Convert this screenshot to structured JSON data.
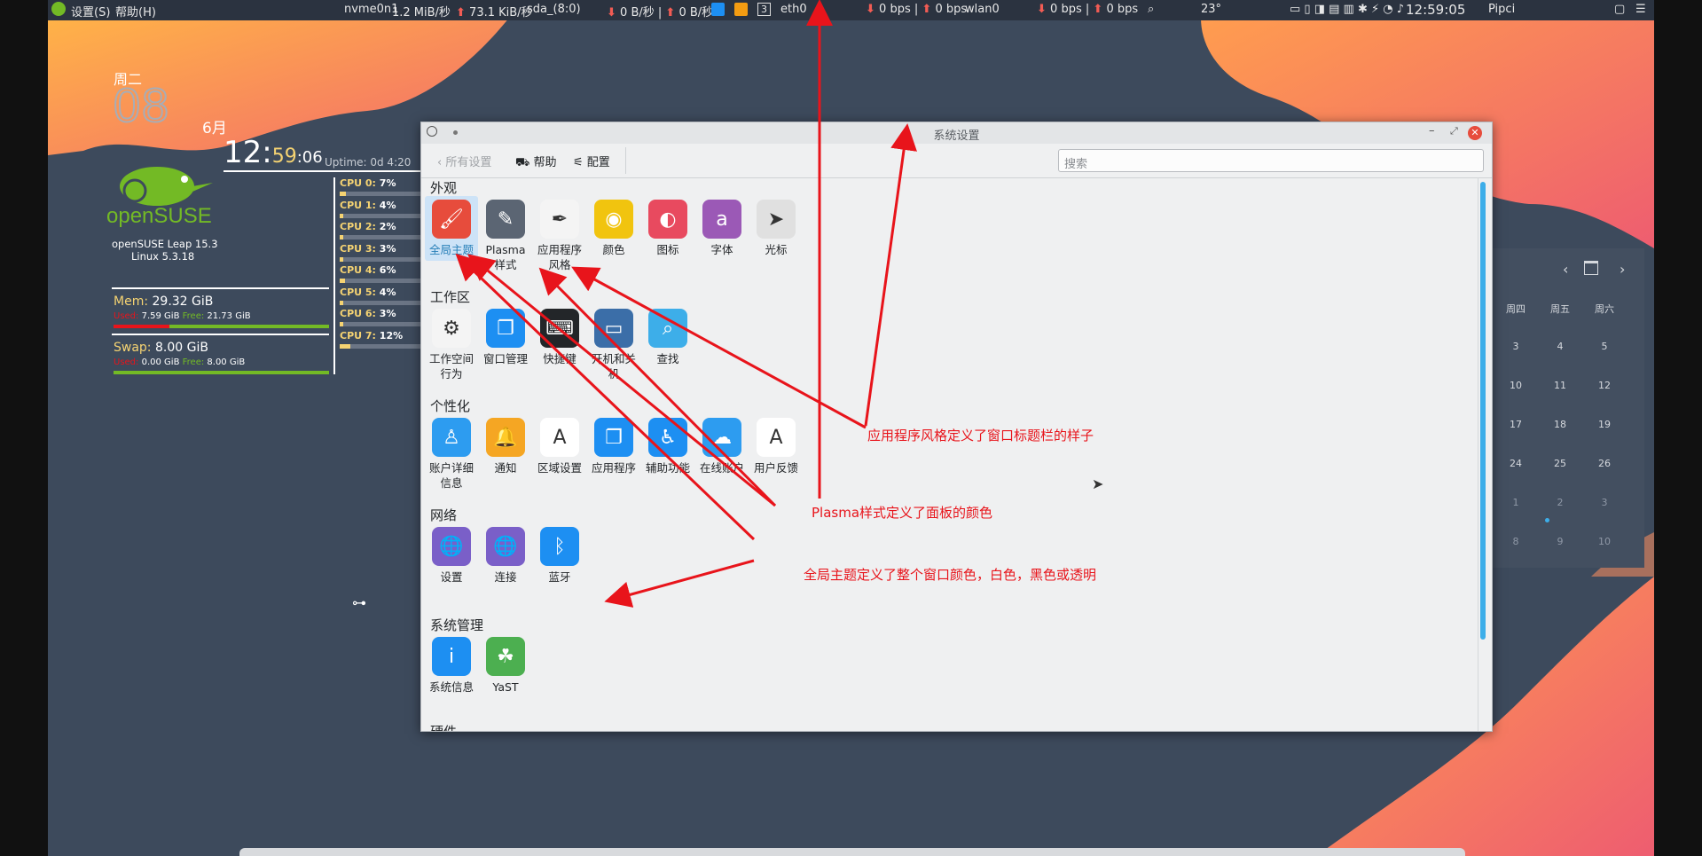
{
  "top_panel": {
    "menu_settings": "设置(S)",
    "menu_help": "帮助(H)",
    "disk_nvme": "nvme0n1",
    "disk_rate": "1.2 MiB/秒",
    "disk_up": "73.1 KiB/秒",
    "disk_sda": "sda_(8:0)",
    "sda_down": "0 B/秒",
    "sda_up": "0 B/秒",
    "workspace": "3",
    "eth": "eth0",
    "eth_down": "0 bps",
    "eth_up": "0 bps",
    "wlan": "wlan0",
    "wlan_down": "0 bps",
    "wlan_up": "0 bps",
    "weather": "23°",
    "battery": "100%",
    "clock": "12:59:05",
    "user": "Pipci"
  },
  "conky": {
    "weekday": "周二",
    "day": "08",
    "month": "6月",
    "time_hm": "12:",
    "time_m": "59",
    "time_s": ":06",
    "uptime": "Uptime: 0d 4:20",
    "os_logo": "openSUSE",
    "os_name": "openSUSE Leap 15.3",
    "kernel": "Linux 5.3.18",
    "mem_label": "Mem:",
    "mem_total": "29.32 GiB",
    "mem_used_label": "Used:",
    "mem_used": "7.59 GiB",
    "mem_free_label": "Free:",
    "mem_free": "21.73 GiB",
    "mem_used_frac": 0.26,
    "swap_label": "Swap:",
    "swap_total": "8.00 GiB",
    "swap_used_label": "Used:",
    "swap_used": "0.00 GiB",
    "swap_free_label": "Free:",
    "swap_free": "8.00 GiB",
    "swap_used_frac": 0.0,
    "cpus": [
      {
        "label": "CPU 0:",
        "value": "7%",
        "frac": 0.07
      },
      {
        "label": "CPU 1:",
        "value": "4%",
        "frac": 0.04
      },
      {
        "label": "CPU 2:",
        "value": "2%",
        "frac": 0.02
      },
      {
        "label": "CPU 3:",
        "value": "3%",
        "frac": 0.03
      },
      {
        "label": "CPU 4:",
        "value": "6%",
        "frac": 0.06
      },
      {
        "label": "CPU 5:",
        "value": "4%",
        "frac": 0.04
      },
      {
        "label": "CPU 6:",
        "value": "3%",
        "frac": 0.03
      },
      {
        "label": "CPU 7:",
        "value": "12%",
        "frac": 0.12
      }
    ]
  },
  "window": {
    "title": "系统设置",
    "back_label": "所有设置",
    "help_label": "帮助",
    "config_label": "配置",
    "search_placeholder": "搜索",
    "sections": [
      {
        "title": "外观",
        "items": [
          {
            "label": "全局主题",
            "icon": "global-theme-icon",
            "color": "#e74c3c",
            "selected": true
          },
          {
            "label": "Plasma\n样式",
            "icon": "plasma-style-icon",
            "color": "#5b6573"
          },
          {
            "label": "应用程序\n风格",
            "icon": "app-style-icon",
            "color": "#f4f4f4"
          },
          {
            "label": "颜色",
            "icon": "colors-icon",
            "color": "#f1c40f"
          },
          {
            "label": "图标",
            "icon": "icons-icon",
            "color": "#e84a5f"
          },
          {
            "label": "字体",
            "icon": "fonts-icon",
            "color": "#9b59b6"
          },
          {
            "label": "光标",
            "icon": "cursor-icon",
            "color": "#e0e0e0"
          }
        ]
      },
      {
        "title": "工作区",
        "items": [
          {
            "label": "工作空间\n行为",
            "icon": "workspace-behavior-icon",
            "color": "#f4f4f4"
          },
          {
            "label": "窗口管理",
            "icon": "window-management-icon",
            "color": "#1d8ff2"
          },
          {
            "label": "快捷键",
            "icon": "shortcuts-icon",
            "color": "#232629"
          },
          {
            "label": "开机和关\n机",
            "icon": "startup-shutdown-icon",
            "color": "#3b6ea8"
          },
          {
            "label": "查找",
            "icon": "search-icon",
            "color": "#3daee9"
          }
        ]
      },
      {
        "title": "个性化",
        "items": [
          {
            "label": "账户详细\n信息",
            "icon": "user-account-icon",
            "color": "#2d9cf0"
          },
          {
            "label": "通知",
            "icon": "notification-bell-icon",
            "color": "#f5a623"
          },
          {
            "label": "区域设置",
            "icon": "regional-settings-icon",
            "color": "#ffffff"
          },
          {
            "label": "应用程序",
            "icon": "applications-icon",
            "color": "#1d8ff2"
          },
          {
            "label": "辅助功能",
            "icon": "accessibility-icon",
            "color": "#1d8ff2"
          },
          {
            "label": "在线账户",
            "icon": "online-accounts-icon",
            "color": "#2d9cf0"
          },
          {
            "label": "用户反馈",
            "icon": "user-feedback-icon",
            "color": "#ffffff"
          }
        ]
      },
      {
        "title": "网络",
        "items": [
          {
            "label": "设置",
            "icon": "network-settings-icon",
            "color": "#7a5fc8"
          },
          {
            "label": "连接",
            "icon": "connections-icon",
            "color": "#7a5fc8"
          },
          {
            "label": "蓝牙",
            "icon": "bluetooth-icon",
            "color": "#1d8ff2"
          }
        ]
      },
      {
        "title": "系统管理",
        "items": [
          {
            "label": "系统信息",
            "icon": "info-icon",
            "color": "#1d8ff2"
          },
          {
            "label": "YaST",
            "icon": "yast-chameleon-icon",
            "color": "#4caf50"
          }
        ]
      }
    ],
    "truncated_section": "硬件"
  },
  "calendar": {
    "headers": [
      "周四",
      "周五",
      "周六"
    ],
    "rows": [
      [
        "3",
        "4",
        "5"
      ],
      [
        "10",
        "11",
        "12"
      ],
      [
        "17",
        "18",
        "19"
      ],
      [
        "24",
        "25",
        "26"
      ],
      [
        "1",
        "2",
        "3"
      ],
      [
        "8",
        "9",
        "10"
      ]
    ]
  },
  "annotations": {
    "app_style": "应用程序风格定义了窗口标题栏的样子",
    "plasma_style": "Plasma样式定义了面板的颜色",
    "global_theme": "全局主题定义了整个窗口颜色，白色，黑色或透明"
  },
  "colors": {
    "annotation": "#e8141b",
    "accent": "#3daee9",
    "conky_yellow": "#f5d372"
  }
}
